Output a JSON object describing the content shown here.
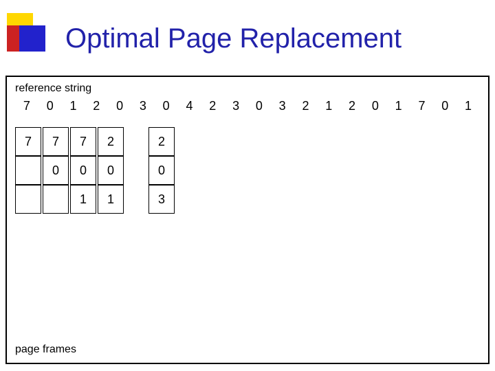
{
  "header": {
    "title": "Optimal Page Replacement"
  },
  "content": {
    "reference_string_label": "reference string",
    "page_frames_label": "page frames",
    "reference_numbers": [
      "7",
      "0",
      "1",
      "2",
      "0",
      "3",
      "0",
      "4",
      "2",
      "3",
      "0",
      "3",
      "2",
      "1",
      "2",
      "0",
      "1",
      "7",
      "0",
      "1"
    ],
    "frame_columns": [
      {
        "cells": [
          "7",
          "",
          ""
        ],
        "show": true
      },
      {
        "cells": [
          "7",
          "0",
          ""
        ],
        "show": true
      },
      {
        "cells": [
          "7",
          "0",
          "1"
        ],
        "show": true
      },
      {
        "cells": [
          "2",
          "0",
          "1"
        ],
        "show": true
      },
      {
        "cells": [
          "",
          "",
          ""
        ],
        "show": false
      },
      {
        "cells": [
          "2",
          "0",
          "3"
        ],
        "show": true
      },
      {
        "cells": [
          "",
          "",
          ""
        ],
        "show": false
      },
      {
        "cells": [
          "",
          "",
          ""
        ],
        "show": false
      },
      {
        "cells": [
          "",
          "",
          ""
        ],
        "show": false
      },
      {
        "cells": [
          "",
          "",
          ""
        ],
        "show": false
      },
      {
        "cells": [
          "",
          "",
          ""
        ],
        "show": false
      },
      {
        "cells": [
          "",
          "",
          ""
        ],
        "show": false
      },
      {
        "cells": [
          "",
          "",
          ""
        ],
        "show": false
      },
      {
        "cells": [
          "",
          "",
          ""
        ],
        "show": false
      },
      {
        "cells": [
          "",
          "",
          ""
        ],
        "show": false
      },
      {
        "cells": [
          "",
          "",
          ""
        ],
        "show": false
      },
      {
        "cells": [
          "",
          "",
          ""
        ],
        "show": false
      },
      {
        "cells": [
          "",
          "",
          ""
        ],
        "show": false
      },
      {
        "cells": [
          "",
          "",
          ""
        ],
        "show": false
      },
      {
        "cells": [
          "",
          "",
          ""
        ],
        "show": false
      }
    ]
  }
}
